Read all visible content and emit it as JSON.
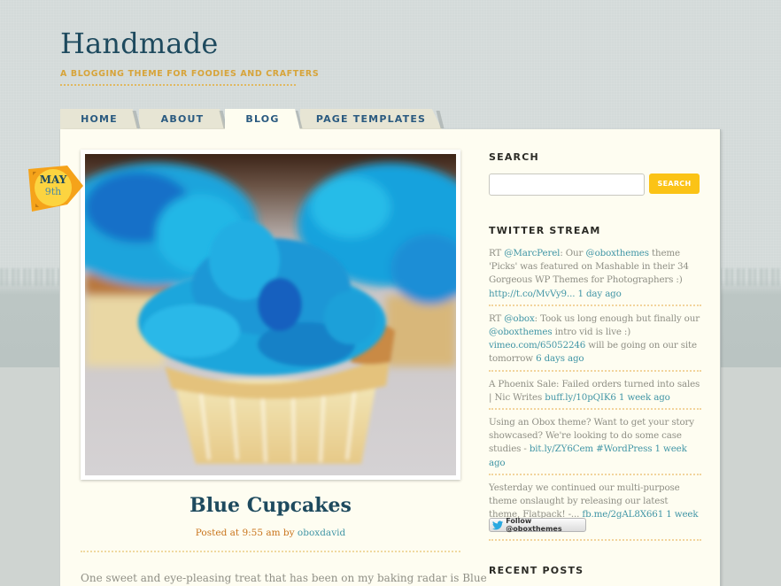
{
  "site": {
    "title": "Handmade",
    "tagline": "A BLOGGING THEME FOR FOODIES AND CRAFTERS"
  },
  "nav": {
    "tabs": [
      {
        "label": "HOME",
        "active": false
      },
      {
        "label": "ABOUT",
        "active": false
      },
      {
        "label": "BLOG",
        "active": true
      },
      {
        "label": "PAGE TEMPLATES",
        "active": false
      }
    ]
  },
  "post": {
    "date_month": "MAY",
    "date_day": "9th",
    "image_alt": "Blue frosted cupcakes",
    "title": "Blue Cupcakes",
    "meta_prefix": "Posted at 9:55 am by",
    "author": "oboxdavid",
    "excerpt": "One sweet and eye-pleasing treat that has been on my baking radar is Blue"
  },
  "sidebar": {
    "search": {
      "title": "SEARCH",
      "input_value": "",
      "input_placeholder": "",
      "button_label": "SEARCH"
    },
    "twitter": {
      "title": "TWITTER STREAM",
      "tweets": [
        {
          "parts": [
            {
              "text": "RT ",
              "link": false
            },
            {
              "text": "@MarcPerel",
              "link": true
            },
            {
              "text": ": Our ",
              "link": false
            },
            {
              "text": "@oboxthemes",
              "link": true
            },
            {
              "text": " theme 'Picks' was featured on Mashable in their 34 Gorgeous WP Themes for Photographers :) ",
              "link": false
            },
            {
              "text": "http://t.co/MvVy9...",
              "link": true
            },
            {
              "text": " ",
              "link": false
            },
            {
              "text": "1 day ago",
              "link": true
            }
          ]
        },
        {
          "parts": [
            {
              "text": "RT ",
              "link": false
            },
            {
              "text": "@obox",
              "link": true
            },
            {
              "text": ": Took us long enough but finally our ",
              "link": false
            },
            {
              "text": "@oboxthemes",
              "link": true
            },
            {
              "text": " intro vid is live :) ",
              "link": false
            },
            {
              "text": "vimeo.com/65052246",
              "link": true
            },
            {
              "text": " will be going on our site tomorrow ",
              "link": false
            },
            {
              "text": "6 days ago",
              "link": true
            }
          ]
        },
        {
          "parts": [
            {
              "text": "A Phoenix Sale: Failed orders turned into sales | Nic Writes ",
              "link": false
            },
            {
              "text": "buff.ly/10pQIK6",
              "link": true
            },
            {
              "text": " ",
              "link": false
            },
            {
              "text": "1 week ago",
              "link": true
            }
          ]
        },
        {
          "parts": [
            {
              "text": "Using an Obox theme? Want to get your story showcased? We're looking to do some case studies - ",
              "link": false
            },
            {
              "text": "bit.ly/ZY6Cem",
              "link": true
            },
            {
              "text": " ",
              "link": false
            },
            {
              "text": "#WordPress",
              "link": true
            },
            {
              "text": " ",
              "link": false
            },
            {
              "text": "1 week ago",
              "link": true
            }
          ]
        },
        {
          "parts": [
            {
              "text": "Yesterday we continued our multi-purpose theme onslaught by releasing our latest theme, Flatpack! -... ",
              "link": false
            },
            {
              "text": "fb.me/2gAL8X661",
              "link": true
            },
            {
              "text": " ",
              "link": false
            },
            {
              "text": "1 week ago",
              "link": true
            }
          ]
        }
      ],
      "follow_label": "Follow @oboxthemes"
    },
    "recent_posts": {
      "title": "RECENT POSTS"
    }
  },
  "colors": {
    "title_blue": "#1e4a5e",
    "tagline_gold": "#d7a43a",
    "nav_text": "#2a5a80",
    "link_teal": "#4296a6",
    "meta_orange": "#c9741c",
    "search_yellow": "#fbc316",
    "panel_bg": "#fefdf1",
    "badge_orange": "#f5a31a",
    "badge_yellow": "#fcd440"
  },
  "icons": {
    "twitter_bird": "twitter-bird-icon"
  }
}
